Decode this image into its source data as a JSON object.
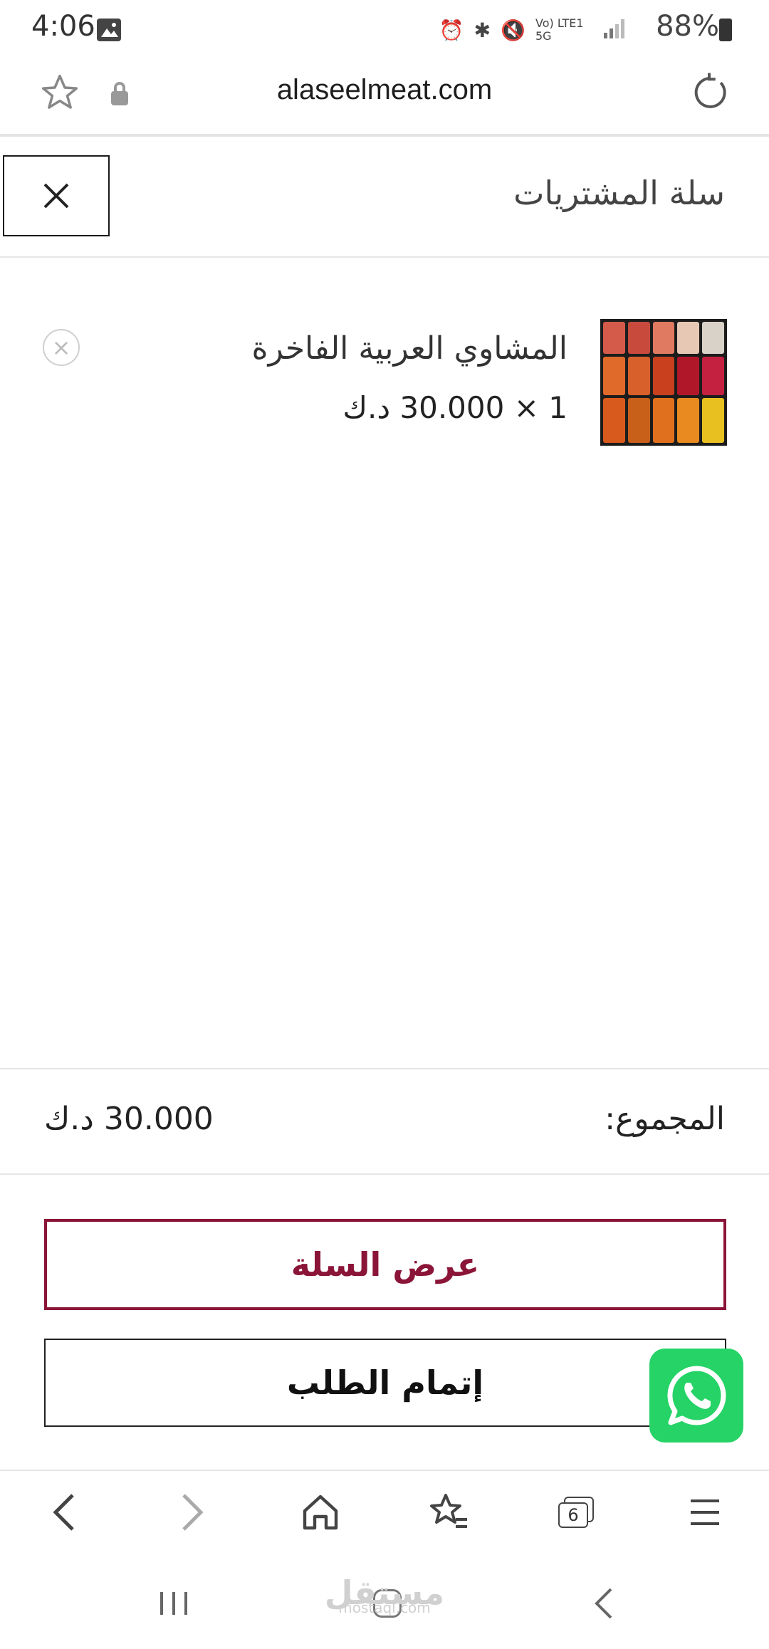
{
  "status_bar": {
    "time": "4:06",
    "network": "Vo) LTE1 5G",
    "battery": "88%"
  },
  "browser": {
    "url": "alaseelmeat.com"
  },
  "cart": {
    "title": "سلة المشتريات",
    "item": {
      "name": "المشاوي العربية الفاخرة",
      "quantity_price": "1 × 30.000 د.ك"
    },
    "total_label": "المجموع:",
    "total_value": "30.000 د.ك",
    "view_cart_label": "عرض السلة",
    "checkout_label": "إتمام الطلب"
  },
  "toolbar": {
    "tabs_count": "6"
  },
  "watermark": {
    "text": "مستقل",
    "sub": "mostaql.com"
  },
  "colors": {
    "accent": "#8b1538",
    "whatsapp": "#25d366"
  }
}
